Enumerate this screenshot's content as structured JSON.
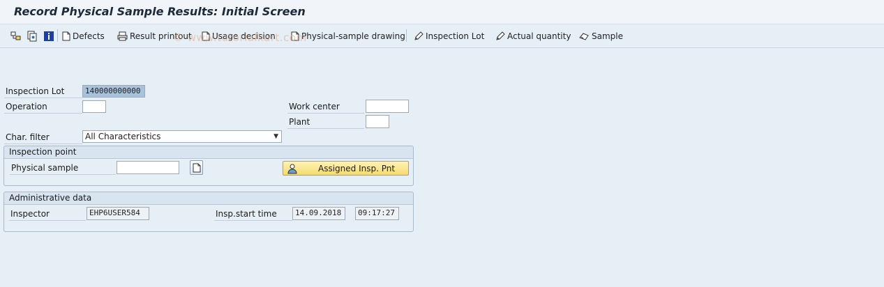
{
  "title": "Record Physical Sample Results: Initial Screen",
  "toolbar": {
    "defects": "Defects",
    "result_printout": "Result printout",
    "usage_decision": "Usage decision",
    "physical_sample_drawing": "Physical-sample drawing",
    "inspection_lot": "Inspection Lot",
    "actual_quantity": "Actual quantity",
    "sample": "Sample"
  },
  "watermark": "© www.tutorialkart.com",
  "form": {
    "inspection_lot_label": "Inspection Lot",
    "inspection_lot_value": "140000000000",
    "operation_label": "Operation",
    "operation_value": "",
    "work_center_label": "Work center",
    "work_center_value": "",
    "plant_label": "Plant",
    "plant_value": "",
    "char_filter_label": "Char. filter",
    "char_filter_value": "All Characteristics"
  },
  "inspection_point": {
    "header": "Inspection point",
    "physical_sample_label": "Physical sample",
    "physical_sample_value": "",
    "assigned_button": "Assigned Insp. Pnt"
  },
  "admin": {
    "header": "Administrative data",
    "inspector_label": "Inspector",
    "inspector_value": "EHP6USER584",
    "start_time_label": "Insp.start time",
    "start_date": "14.09.2018",
    "start_time": "09:17:27"
  }
}
